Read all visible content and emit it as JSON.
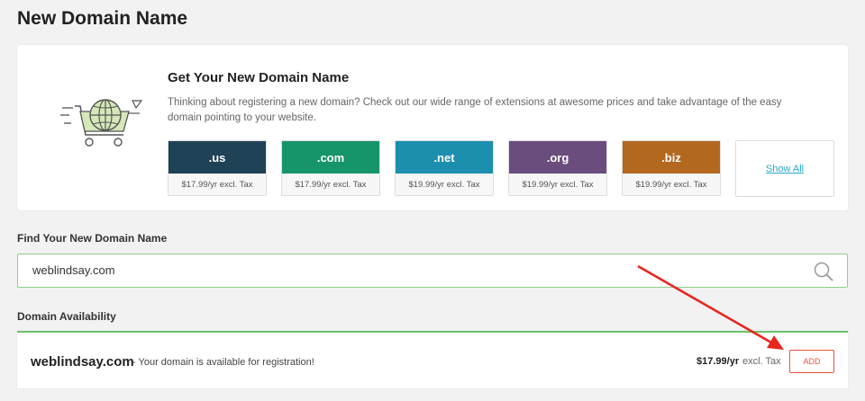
{
  "page": {
    "title": "New Domain Name"
  },
  "promo": {
    "heading": "Get Your New Domain Name",
    "description": "Thinking about registering a new domain? Check out our wide range of extensions at awesome prices and take advantage of the easy domain pointing to your website.",
    "tlds": [
      {
        "name": ".us",
        "price": "$17.99/yr excl. Tax",
        "color": "#1f4257"
      },
      {
        "name": ".com",
        "price": "$17.99/yr excl. Tax",
        "color": "#17956a"
      },
      {
        "name": ".net",
        "price": "$19.99/yr excl. Tax",
        "color": "#1c8fae"
      },
      {
        "name": ".org",
        "price": "$19.99/yr excl. Tax",
        "color": "#6a4d7d"
      },
      {
        "name": ".biz",
        "price": "$19.99/yr excl. Tax",
        "color": "#b3681f"
      }
    ],
    "show_all": "Show All"
  },
  "search": {
    "label": "Find Your New Domain Name",
    "value": "weblindsay.com",
    "icon": "search-icon"
  },
  "availability": {
    "label": "Domain Availability",
    "domain": "weblindsay.com",
    "message": "- Your domain is available for registration!",
    "price": "$17.99/yr",
    "price_suffix": "excl. Tax",
    "add_label": "ADD"
  },
  "colors": {
    "accent_green": "#6cc36a",
    "add_button": "#e8533a",
    "annotation_arrow": "#e8271f",
    "link": "#29a8c9"
  }
}
